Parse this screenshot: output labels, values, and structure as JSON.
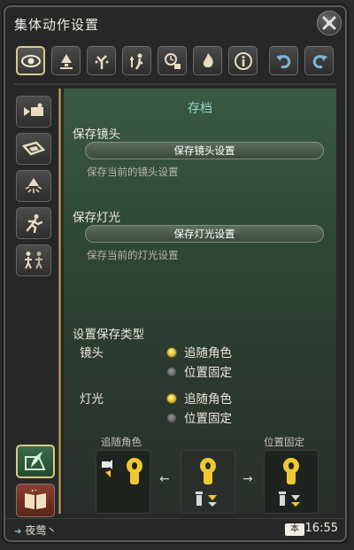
{
  "window": {
    "title": "集体动作设置"
  },
  "toolbar": {
    "items": [
      {
        "icon": "eye-icon",
        "active": true
      },
      {
        "icon": "lamp-icon",
        "active": false
      },
      {
        "icon": "tree-sparkle-icon",
        "active": false
      },
      {
        "icon": "character-effect-icon",
        "active": false
      },
      {
        "icon": "timer-lock-icon",
        "active": false
      },
      {
        "icon": "fire-effect-icon",
        "active": false
      },
      {
        "icon": "info-icon",
        "active": false
      },
      {
        "icon": "undo-icon",
        "active": false
      },
      {
        "icon": "redo-icon",
        "active": false
      }
    ]
  },
  "sidebar": {
    "items": [
      {
        "icon": "camera-icon"
      },
      {
        "icon": "frame-icon"
      },
      {
        "icon": "light-icon"
      },
      {
        "icon": "running-icon"
      },
      {
        "icon": "characters-icon"
      }
    ],
    "bottom": [
      {
        "icon": "save-feather-icon",
        "active": true
      },
      {
        "icon": "book-icon",
        "active": false
      }
    ]
  },
  "panel": {
    "title": "存档",
    "camera": {
      "label": "保存镜头",
      "button": "保存镜头设置",
      "desc": "保存当前的镜头设置"
    },
    "light": {
      "label": "保存灯光",
      "button": "保存灯光设置",
      "desc": "保存当前的灯光设置"
    },
    "save_type": {
      "label": "设置保存类型",
      "camera_label": "镜头",
      "light_label": "灯光",
      "camera_options": [
        {
          "label": "追随角色",
          "selected": true
        },
        {
          "label": "位置固定",
          "selected": false
        }
      ],
      "light_options": [
        {
          "label": "追随角色",
          "selected": true
        },
        {
          "label": "位置固定",
          "selected": false
        }
      ]
    },
    "diagram": {
      "left_label": "追随角色",
      "right_label": "位置固定",
      "left_arrow": "←",
      "right_arrow": "→"
    }
  },
  "footer": {
    "player": "夜莺丶",
    "badge": "本",
    "time": "16:55"
  },
  "colors": {
    "accent_gold": "#e0b52a",
    "section_title": "#8fd8c6",
    "panel_green": "#3a5a44"
  }
}
